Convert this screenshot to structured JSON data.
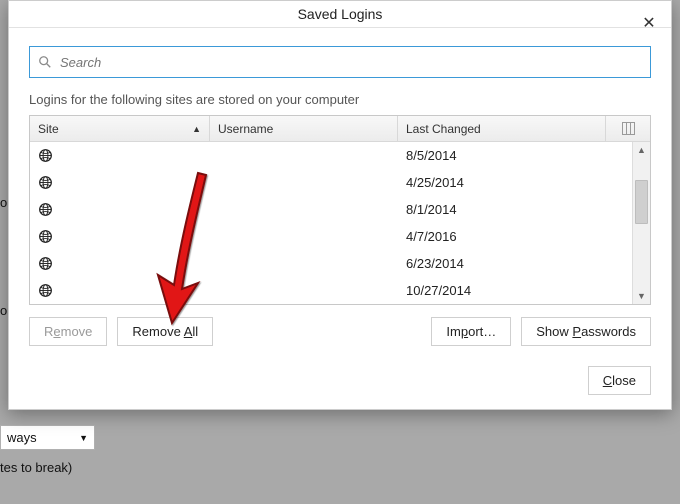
{
  "dialog": {
    "title": "Saved Logins",
    "search_placeholder": "Search",
    "description": "Logins for the following sites are stored on your computer",
    "columns": {
      "site": "Site",
      "username": "Username",
      "last_changed": "Last Changed"
    },
    "rows": [
      {
        "site": "",
        "username": "",
        "last_changed": "8/5/2014"
      },
      {
        "site": "",
        "username": "",
        "last_changed": "4/25/2014"
      },
      {
        "site": "",
        "username": "",
        "last_changed": "8/1/2014"
      },
      {
        "site": "",
        "username": "",
        "last_changed": "4/7/2016"
      },
      {
        "site": "",
        "username": "",
        "last_changed": "6/23/2014"
      },
      {
        "site": "",
        "username": "",
        "last_changed": "10/27/2014"
      }
    ],
    "buttons": {
      "remove_pre": "R",
      "remove_accel": "e",
      "remove_post": "move",
      "remove_all_pre": "Remove ",
      "remove_all_accel": "A",
      "remove_all_post": "ll",
      "import_pre": "Im",
      "import_accel": "p",
      "import_post": "ort…",
      "show_pw_pre": "Show ",
      "show_pw_accel": "P",
      "show_pw_post": "asswords",
      "close_pre": "",
      "close_accel": "C",
      "close_post": "lose"
    }
  },
  "background": {
    "ways_label": "ways",
    "break_label": "tes to break)",
    "dot1": "o",
    "dot2": "o"
  }
}
